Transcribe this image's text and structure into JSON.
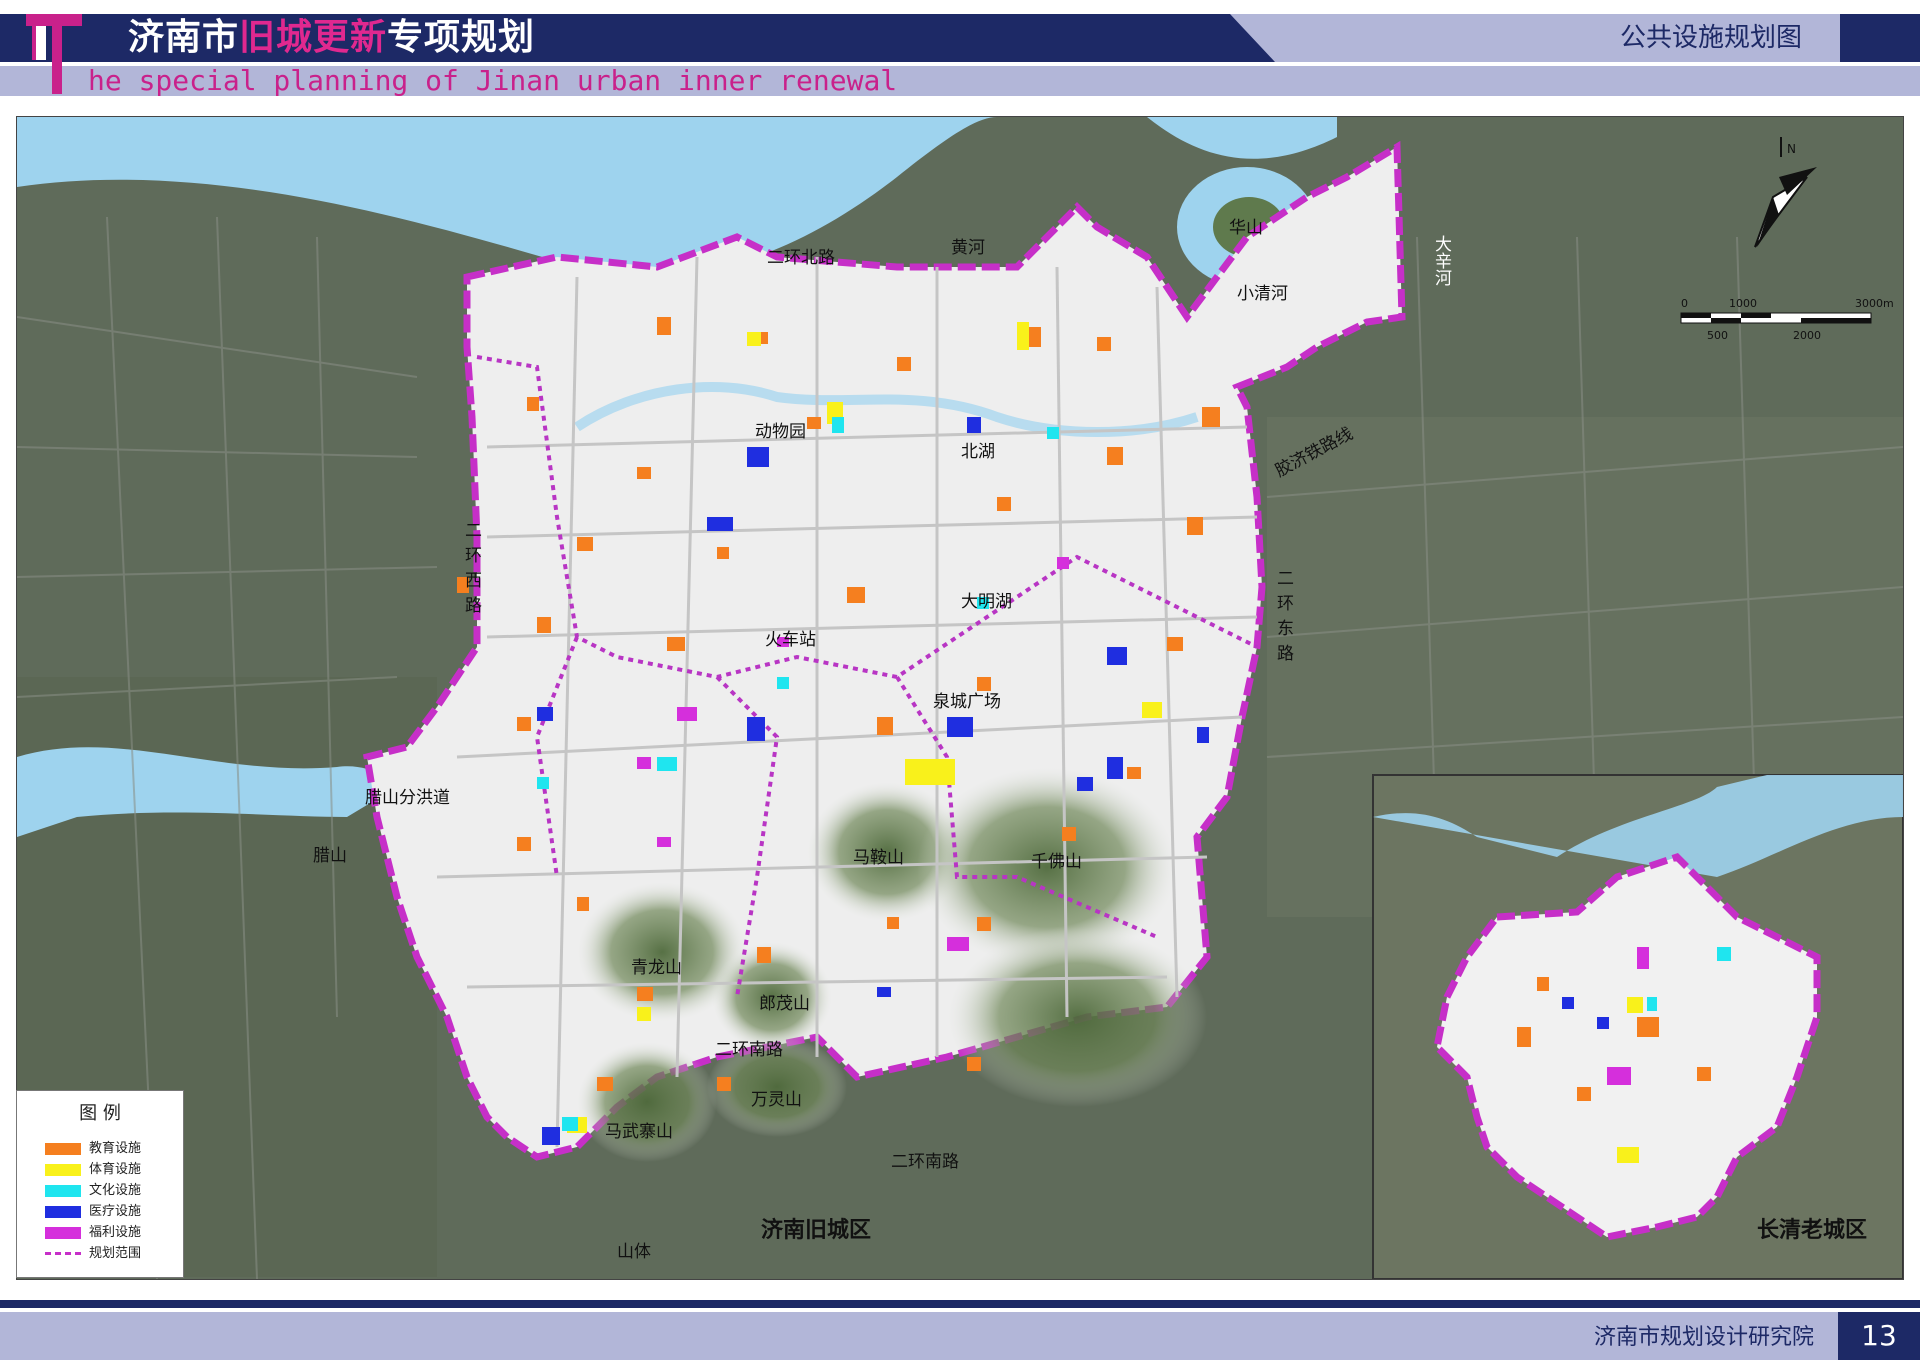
{
  "header": {
    "title_part1": "济南市",
    "title_highlight": "旧城更新",
    "title_part2": "专项规划",
    "subtitle": "he special planning of Jinan urban inner renewal",
    "map_type": "公共设施规划图"
  },
  "footer": {
    "institute": "济南市规划设计研究院",
    "page_number": "13"
  },
  "legend": {
    "title": "图  例",
    "items": [
      {
        "label": "教育设施",
        "color": "#f57f1f"
      },
      {
        "label": "体育设施",
        "color": "#f9f11b"
      },
      {
        "label": "文化设施",
        "color": "#1fe5ef"
      },
      {
        "label": "医疗设施",
        "color": "#1f2ee0"
      },
      {
        "label": "福利设施",
        "color": "#d52fdc"
      },
      {
        "label": "规划范围",
        "color": "#c62fc8"
      }
    ]
  },
  "compass": {
    "north": "N"
  },
  "scale_bar": {
    "labels": [
      "0",
      "1000",
      "3000m",
      "500",
      "2000"
    ]
  },
  "map_labels": {
    "erhuan_beilu": "二环北路",
    "huanghe": "黄河",
    "huashan": "华山",
    "xiaoqinghe": "小清河",
    "daxinhe": "大辛河",
    "dongwuyuan": "动物园",
    "beihu": "北湖",
    "jiaojitielu": "胶济铁路线",
    "erhuan_xilu": "二环西路",
    "daminghu": "大明湖",
    "huochezhan": "火车站",
    "quancheng": "泉城广场",
    "erhuan_donglu": "二环东路",
    "lashan_fenhong": "腊山分洪道",
    "lashan": "腊山",
    "maanshan": "马鞍山",
    "qianfoshan": "千佛山",
    "qinglongshan": "青龙山",
    "langmaoshan": "郎茂山",
    "erhuan_nanlu_mid": "二环南路",
    "wanlingshan": "万灵山",
    "mawuzhaishan": "马武寨山",
    "erhuan_nanlu": "二环南路",
    "shanti": "山体",
    "old_city": "济南旧城区",
    "changqing": "长清老城区"
  }
}
